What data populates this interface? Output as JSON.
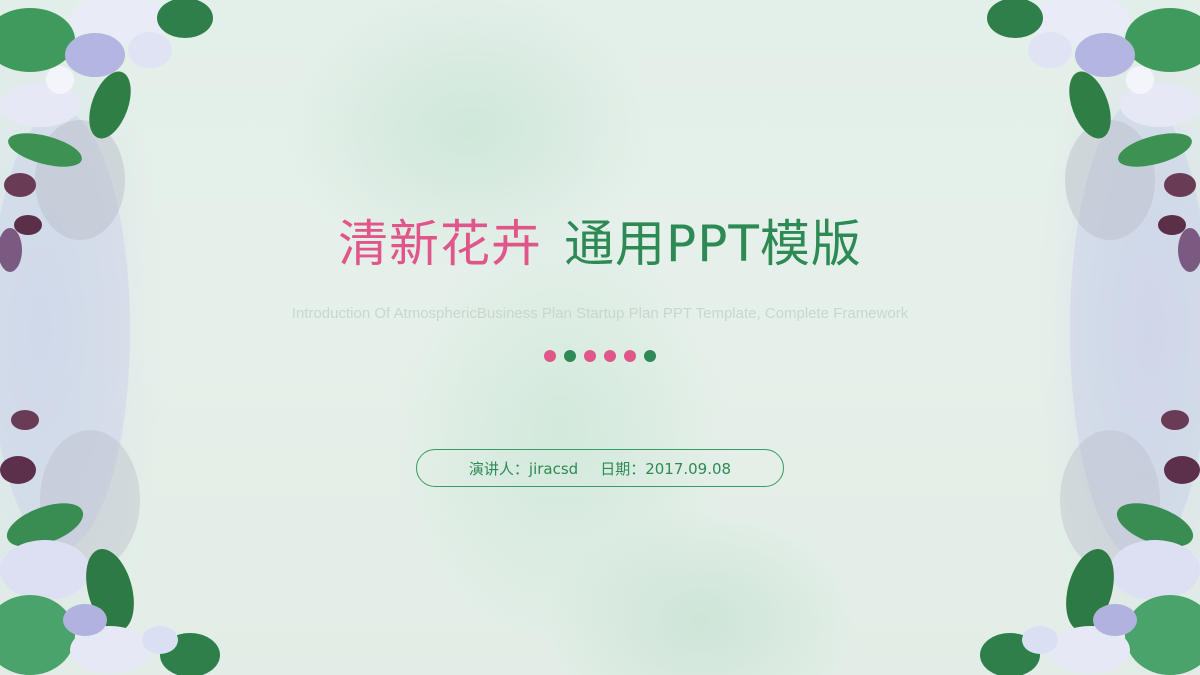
{
  "title": {
    "part1": "清新花卉",
    "part2": "通用PPT模版",
    "part1_color": "#e0568a",
    "part2_color": "#2e8a55"
  },
  "subtitle": "Introduction Of AtmosphericBusiness Plan Startup Plan PPT Template, Complete Framework",
  "dots": [
    {
      "color": "#e0568a"
    },
    {
      "color": "#2e8a55"
    },
    {
      "color": "#e0568a"
    },
    {
      "color": "#e0568a"
    },
    {
      "color": "#e0568a"
    },
    {
      "color": "#2e8a55"
    }
  ],
  "info": {
    "presenter": "演讲人：jiracsd",
    "date": "日期：2017.09.08"
  },
  "decorations": {
    "corner_art": "watercolor-floral-corners-icon"
  }
}
